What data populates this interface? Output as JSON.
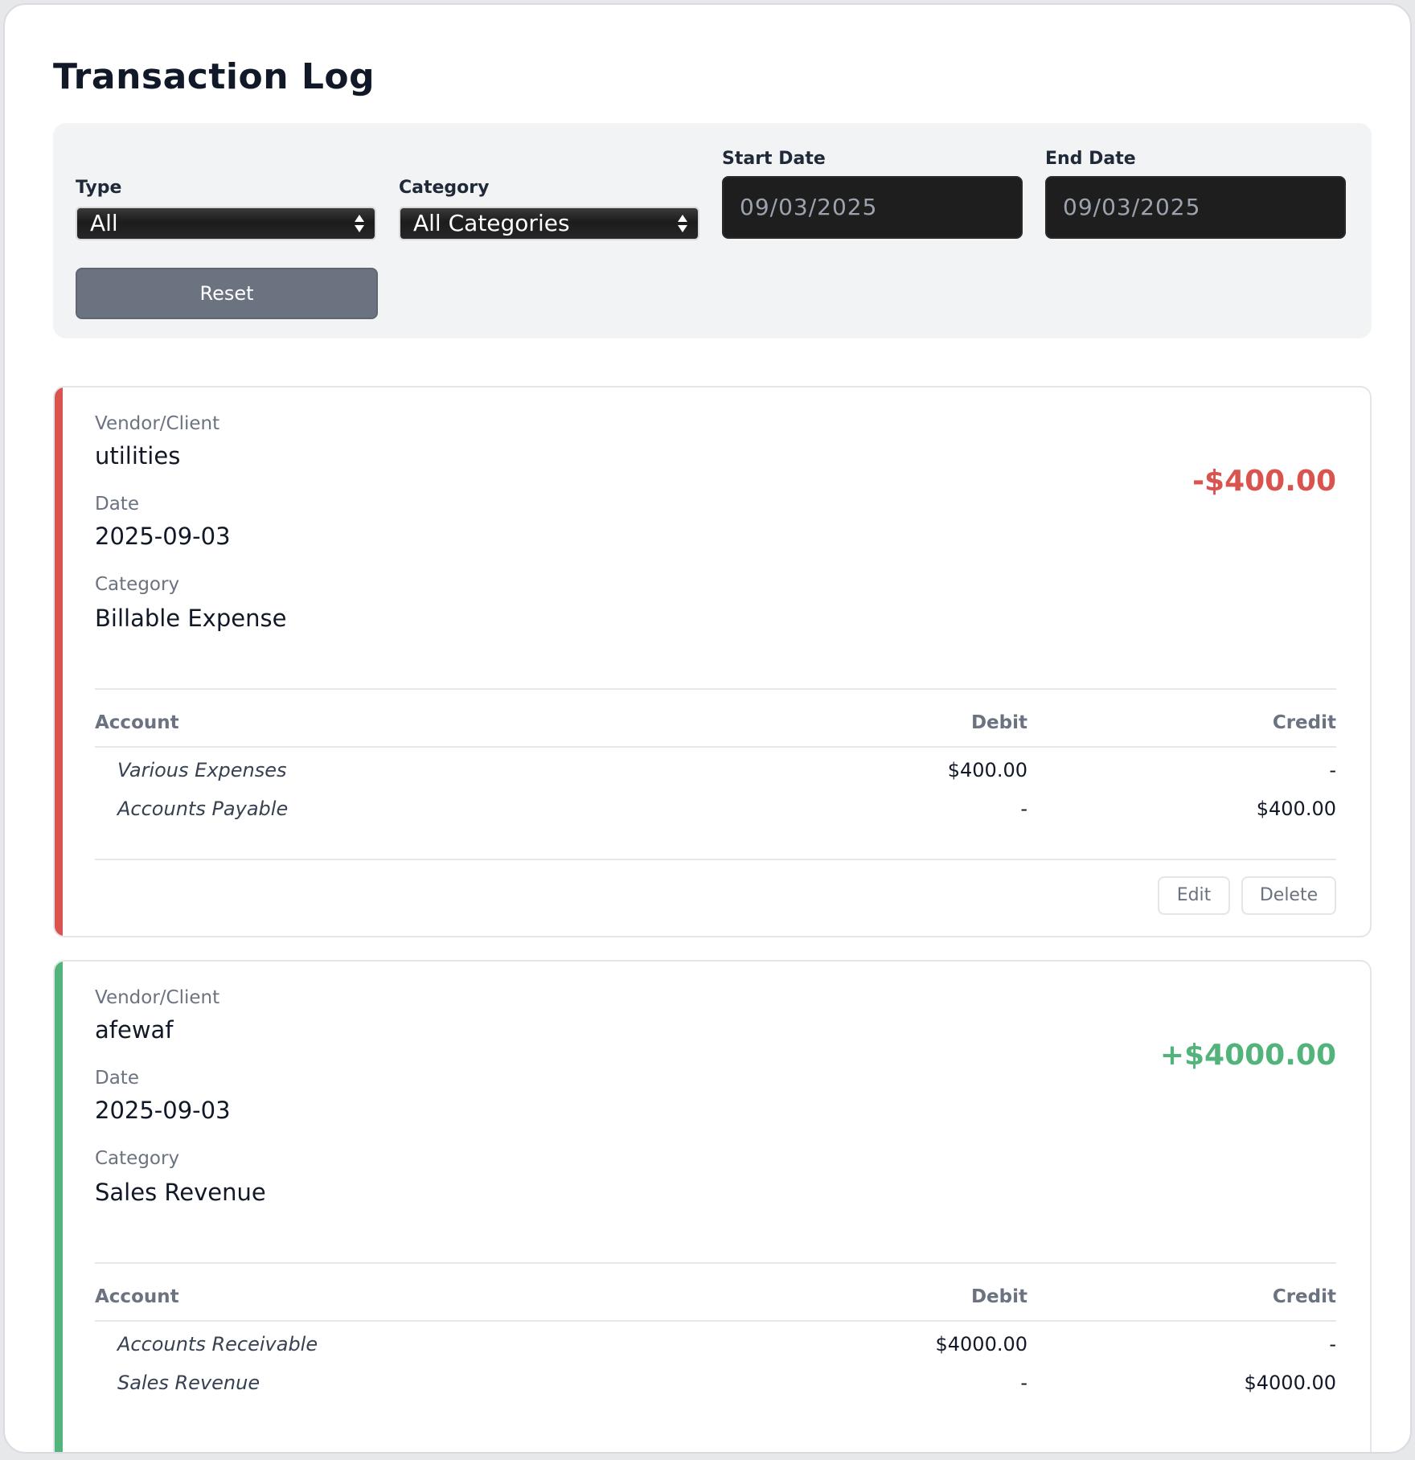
{
  "page": {
    "title": "Transaction Log"
  },
  "filters": {
    "type_label": "Type",
    "type_value": "All",
    "category_label": "Category",
    "category_value": "All Categories",
    "start_label": "Start Date",
    "start_value": "09/03/2025",
    "end_label": "End Date",
    "end_value": "09/03/2025",
    "reset_label": "Reset"
  },
  "colors": {
    "expense": "#d9534f",
    "income": "#52b37b",
    "reset_button": "#6b7280"
  },
  "labels": {
    "vendor": "Vendor/Client",
    "date": "Date",
    "category": "Category",
    "account": "Account",
    "debit": "Debit",
    "credit": "Credit",
    "edit": "Edit",
    "delete": "Delete"
  },
  "transactions": [
    {
      "vendor": "utilities",
      "date": "2025-09-03",
      "category": "Billable Expense",
      "amount": "-$400.00",
      "entries": [
        {
          "account": "Various Expenses",
          "debit": "$400.00",
          "credit": "-"
        },
        {
          "account": "Accounts Payable",
          "debit": "-",
          "credit": "$400.00"
        }
      ]
    },
    {
      "vendor": "afewaf",
      "date": "2025-09-03",
      "category": "Sales Revenue",
      "amount": "+$4000.00",
      "entries": [
        {
          "account": "Accounts Receivable",
          "debit": "$4000.00",
          "credit": "-"
        },
        {
          "account": "Sales Revenue",
          "debit": "-",
          "credit": "$4000.00"
        }
      ]
    }
  ]
}
